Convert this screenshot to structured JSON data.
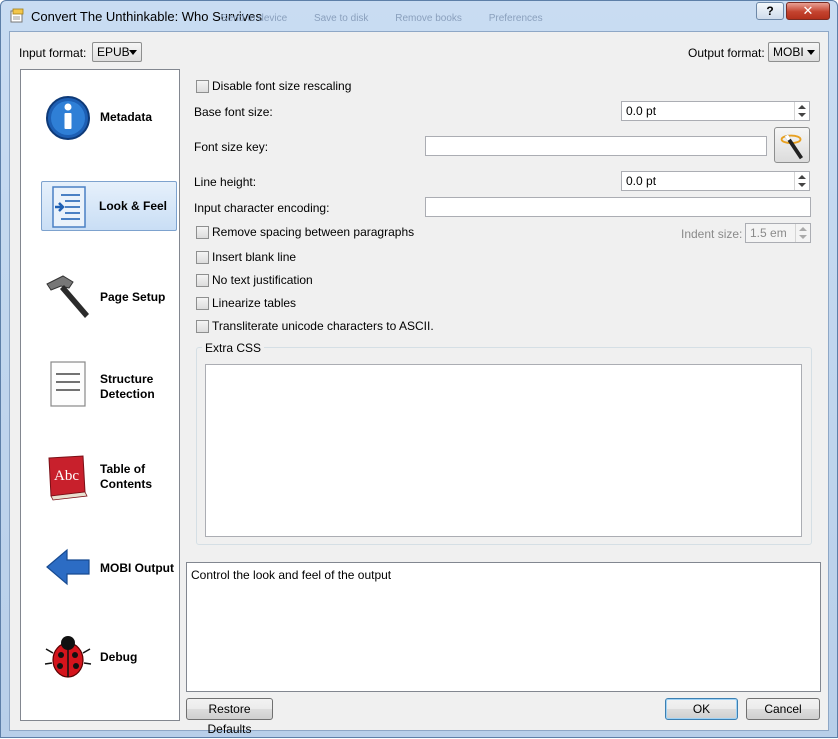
{
  "window": {
    "title": "Convert The Unthinkable: Who Survives",
    "help_label": "?",
    "close_label": "✕",
    "behind_toolbar": [
      "Send to device",
      "Save to disk",
      "Remove books",
      "Preferences"
    ]
  },
  "formats": {
    "input_label": "Input format:",
    "input_value": "EPUB",
    "output_label": "Output format:",
    "output_value": "MOBI"
  },
  "sidebar": {
    "items": [
      {
        "label": "Metadata",
        "icon": "info-icon"
      },
      {
        "label": "Look & Feel",
        "icon": "look-feel-icon",
        "selected": true
      },
      {
        "label": "Page Setup",
        "icon": "hammer-icon"
      },
      {
        "label": "Structure Detection",
        "label_line1": "Structure",
        "label_line2": "Detection",
        "icon": "document-lines-icon"
      },
      {
        "label": "Table of Contents",
        "label_line1": "Table of",
        "label_line2": "Contents",
        "icon": "abc-book-icon"
      },
      {
        "label": "MOBI Output",
        "icon": "arrow-left-icon"
      },
      {
        "label": "Debug",
        "icon": "ladybug-icon"
      }
    ]
  },
  "look_feel": {
    "disable_rescaling": {
      "label": "Disable font size rescaling",
      "checked": false
    },
    "base_font": {
      "label": "Base font size:",
      "value": "0.0 pt"
    },
    "font_key": {
      "label": "Font size key:",
      "value": ""
    },
    "line_height": {
      "label": "Line height:",
      "value": "0.0 pt"
    },
    "encoding": {
      "label": "Input character encoding:",
      "value": ""
    },
    "remove_spacing": {
      "label": "Remove spacing between paragraphs",
      "checked": false
    },
    "indent": {
      "label": "Indent size:",
      "value": "1.5 em"
    },
    "blank_line": {
      "label": "Insert blank line",
      "checked": false
    },
    "no_justify": {
      "label": "No text justification",
      "checked": false
    },
    "linearize": {
      "label": "Linearize tables",
      "checked": false
    },
    "transliterate": {
      "label": "Transliterate unicode characters to ASCII.",
      "checked": false
    },
    "extra_css": {
      "label": "Extra CSS",
      "value": ""
    }
  },
  "help_text": "Control the look and feel of the output",
  "buttons": {
    "restore": "Restore Defaults",
    "ok": "OK",
    "cancel": "Cancel"
  },
  "colors": {
    "titlebar": "#c9dcf2",
    "selection": "#c9def5",
    "close_button": "#c4432f"
  }
}
